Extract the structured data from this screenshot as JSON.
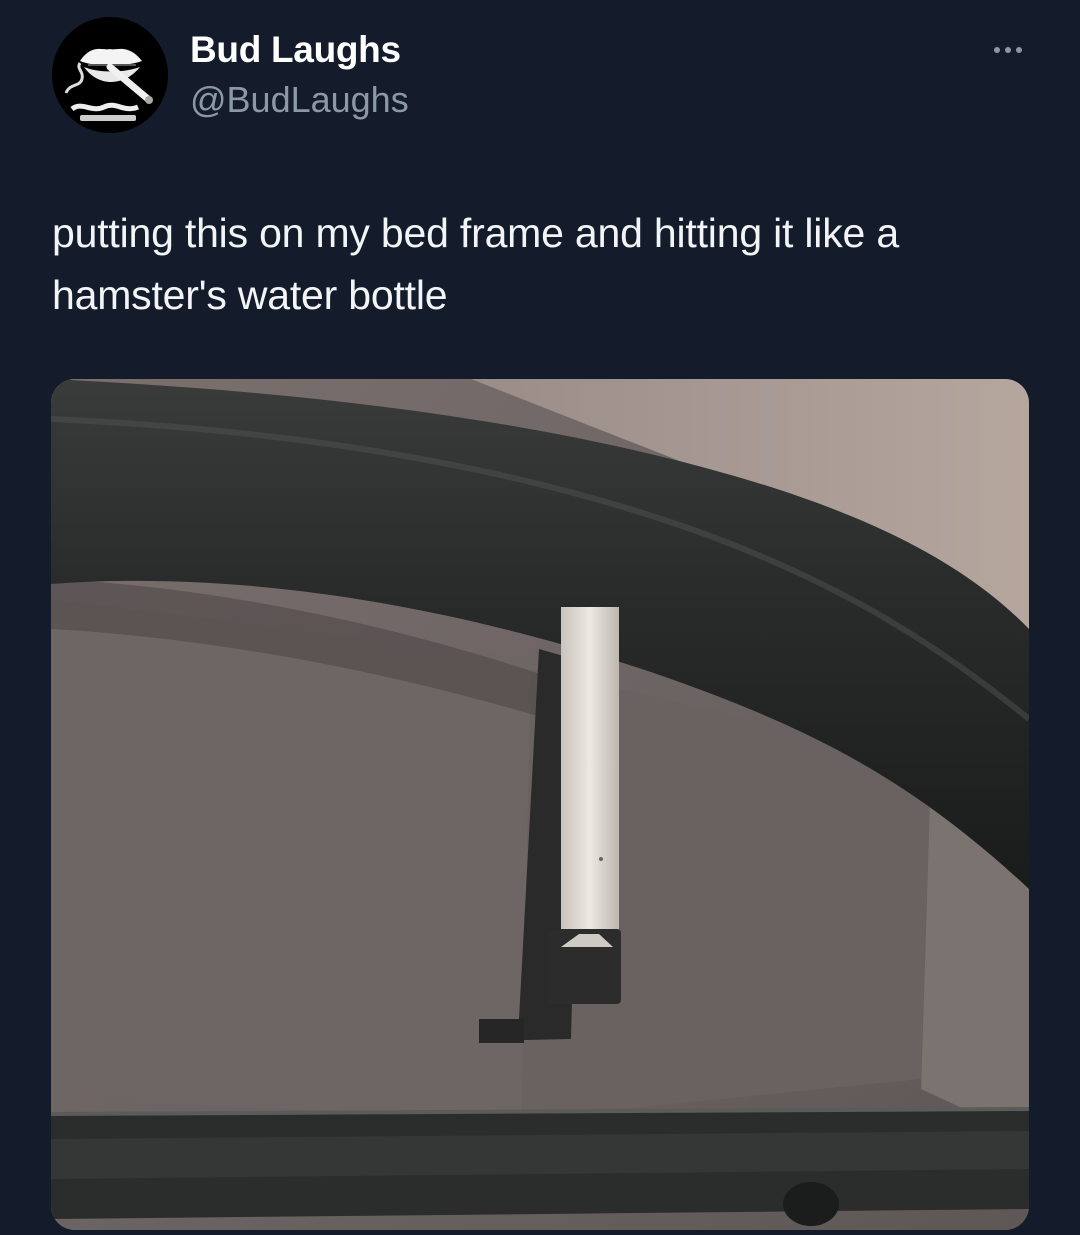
{
  "tweet": {
    "author": {
      "display_name": "Bud Laughs",
      "handle": "@BudLaughs",
      "avatar_icon": "lips-avatar-icon"
    },
    "more_icon": "more-horizontal-icon",
    "text": "putting this on my bed frame and hitting it like a hamster's water bottle",
    "media": {
      "type": "photo",
      "icon": "photo-image"
    }
  },
  "colors": {
    "background": "#141c2b",
    "text_primary": "#ffffff",
    "text_secondary": "#8b98a5"
  }
}
